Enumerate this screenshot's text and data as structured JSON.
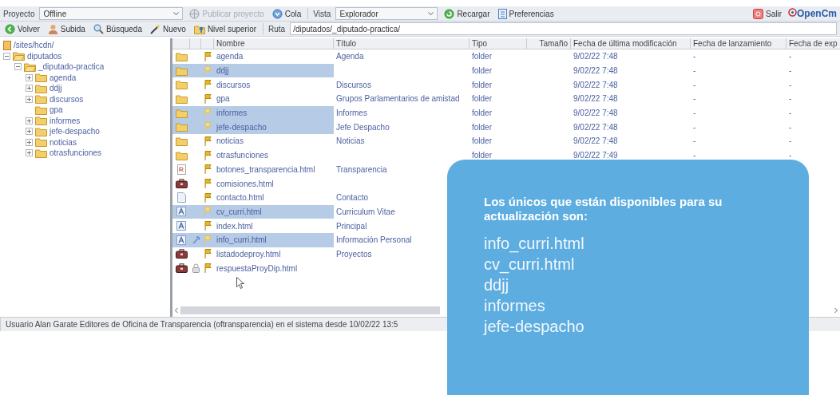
{
  "toolbar": {
    "project_label": "Proyecto",
    "project": "Offline",
    "buttons": [
      {
        "label": "Publicar proyecto",
        "disabled": true
      },
      {
        "label": "Cola",
        "disabled": false
      }
    ],
    "view_label": "Vista",
    "view": "Explorador",
    "buttons_2": [
      {
        "label": "Recargar"
      },
      {
        "label": "Preferencias"
      }
    ],
    "exit": "Salir",
    "logo": "OpenCm"
  },
  "navbar": {
    "buttons": [
      {
        "label": "Volver"
      },
      {
        "label": "Subida"
      },
      {
        "label": "Búsqueda"
      },
      {
        "label": "Nuevo"
      },
      {
        "label": "Nivel superior"
      }
    ],
    "path_label": "Ruta",
    "path": "/diputados/_diputado-practica/"
  },
  "tree": {
    "root": "/sites/hcdn/",
    "items": [
      {
        "label": "diputados",
        "expanded": true,
        "children": [
          {
            "label": "_diputado-practica",
            "expanded": true,
            "children": [
              {
                "label": "agenda",
                "expanded": false,
                "expandable": true
              },
              {
                "label": "ddjj",
                "expanded": false,
                "expandable": true
              },
              {
                "label": "discursos",
                "expanded": false,
                "expandable": true
              },
              {
                "label": "gpa",
                "expanded": false,
                "expandable": false
              },
              {
                "label": "informes",
                "expanded": false,
                "expandable": true
              },
              {
                "label": "jefe-despacho",
                "expanded": false,
                "expandable": true
              },
              {
                "label": "noticias",
                "expanded": false,
                "expandable": true
              },
              {
                "label": "otrasfunciones",
                "expanded": false,
                "expandable": true
              }
            ]
          }
        ]
      }
    ]
  },
  "table": {
    "columns": [
      "Nombre",
      "Título",
      "Tipo",
      "Tamaño",
      "Fecha de última modificación",
      "Fecha de lanzamiento",
      "Fecha de exp"
    ],
    "rows": [
      {
        "kind": "folder",
        "selected": false,
        "linked": false,
        "locked": false,
        "name": "agenda",
        "title": "Agenda",
        "type": "folder",
        "modified": "9/02/22 7:48",
        "released": "-",
        "expires": "-"
      },
      {
        "kind": "folder",
        "selected": true,
        "linked": false,
        "locked": false,
        "name": "ddjj",
        "type": "folder",
        "modified": "9/02/22 7:48",
        "released": "-",
        "expires": "-"
      },
      {
        "kind": "folder",
        "selected": false,
        "linked": false,
        "locked": false,
        "name": "discursos",
        "title": "Discursos",
        "type": "folder",
        "modified": "9/02/22 7:48",
        "released": "-",
        "expires": "-"
      },
      {
        "kind": "folder",
        "selected": false,
        "linked": false,
        "locked": false,
        "name": "gpa",
        "title": "Grupos Parlamentarios de amistad",
        "type": "folder",
        "modified": "9/02/22 7:48",
        "released": "-",
        "expires": "-"
      },
      {
        "kind": "folder",
        "selected": true,
        "linked": false,
        "locked": false,
        "name": "informes",
        "title": "Informes",
        "type": "folder",
        "modified": "9/02/22 7:48",
        "released": "-",
        "expires": "-"
      },
      {
        "kind": "folder",
        "selected": true,
        "linked": false,
        "locked": false,
        "name": "jefe-despacho",
        "title": "Jefe Despacho",
        "type": "folder",
        "modified": "9/02/22 7:48",
        "released": "-",
        "expires": "-"
      },
      {
        "kind": "folder",
        "selected": false,
        "linked": false,
        "locked": false,
        "name": "noticias",
        "title": "Noticias",
        "type": "folder",
        "modified": "9/02/22 7:48",
        "released": "-",
        "expires": "-"
      },
      {
        "kind": "folder",
        "selected": false,
        "linked": false,
        "locked": false,
        "name": "otrasfunciones",
        "type": "folder",
        "modified": "9/02/22 7:49",
        "released": "-",
        "expires": "-"
      },
      {
        "kind": "file",
        "selected": false,
        "linked": false,
        "locked": false,
        "name": "botones_transparencia.html",
        "title": "Transparencia"
      },
      {
        "kind": "toolbox",
        "selected": false,
        "linked": false,
        "locked": false,
        "name": "comisiones.html"
      },
      {
        "kind": "page",
        "selected": false,
        "linked": false,
        "locked": false,
        "name": "contacto.html",
        "title": "Contacto"
      },
      {
        "kind": "xml",
        "selected": true,
        "linked": false,
        "locked": false,
        "name": "cv_curri.html",
        "title": "Curriculum Vitae"
      },
      {
        "kind": "xml",
        "selected": false,
        "linked": false,
        "locked": false,
        "name": "index.html",
        "title": "Principal"
      },
      {
        "kind": "xml",
        "selected": true,
        "linked": true,
        "locked": false,
        "name": "info_curri.html",
        "title": "Información Personal"
      },
      {
        "kind": "toolbox",
        "selected": false,
        "linked": false,
        "locked": false,
        "name": "listadodeproy.html",
        "title": "Proyectos"
      },
      {
        "kind": "toolbox",
        "selected": false,
        "linked": false,
        "locked": true,
        "name": "respuestaProyDip.html"
      }
    ]
  },
  "status_bar": "Usuario Alan Garate Editores de Oficina de Transparencia (oftransparencia) en el sistema desde 10/02/22 13:5",
  "callout": {
    "title": "Los únicos que están disponibles para su actualización son:",
    "items": [
      "info_curri.html",
      "cv_curri.html",
      "ddjj",
      "informes",
      "jefe-despacho"
    ]
  }
}
